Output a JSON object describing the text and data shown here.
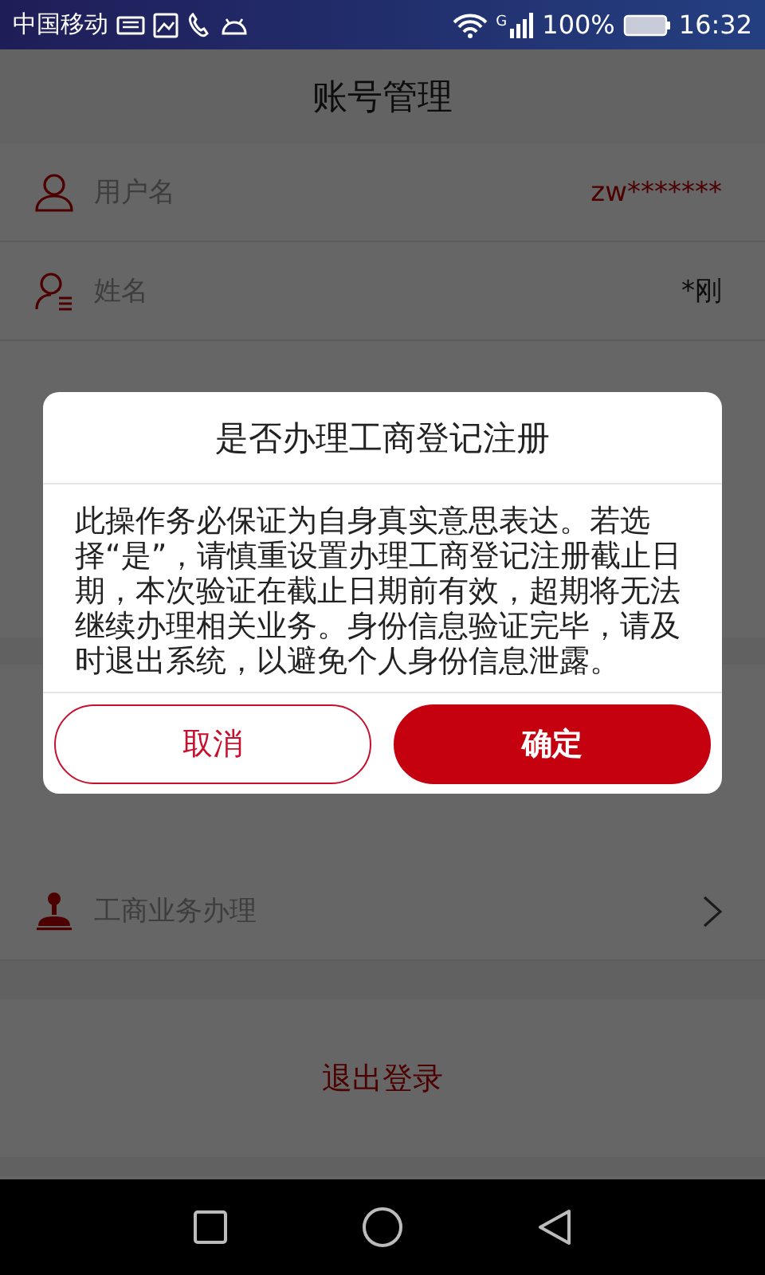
{
  "status_bar": {
    "carrier": "中国移动",
    "network": "G",
    "battery": "100%",
    "time": "16:32"
  },
  "header": {
    "title": "账号管理"
  },
  "account_rows": [
    {
      "kind": "value",
      "label": "用户名",
      "value": "zw*******",
      "highlighted": true
    },
    {
      "kind": "value",
      "label": "姓名",
      "value": "*刚",
      "highlighted": false
    }
  ],
  "service_rows": [
    {
      "kind": "link",
      "label": "工商业务办理"
    }
  ],
  "logout": {
    "label": "退出登录"
  },
  "dialog": {
    "title": "是否办理工商登记注册",
    "message": "此操作务必保证为自身真实意思表达。若选择“是”，请慎重设置办理工商登记注册截止日期，本次验证在截止日期前有效，超期将无法继续办理相关业务。身份信息验证完毕，请及时退出系统，以避免个人身份信息泄露。",
    "buttons": [
      {
        "kind": "secondary",
        "label": "取消"
      },
      {
        "kind": "primary",
        "label": "确定"
      }
    ]
  }
}
